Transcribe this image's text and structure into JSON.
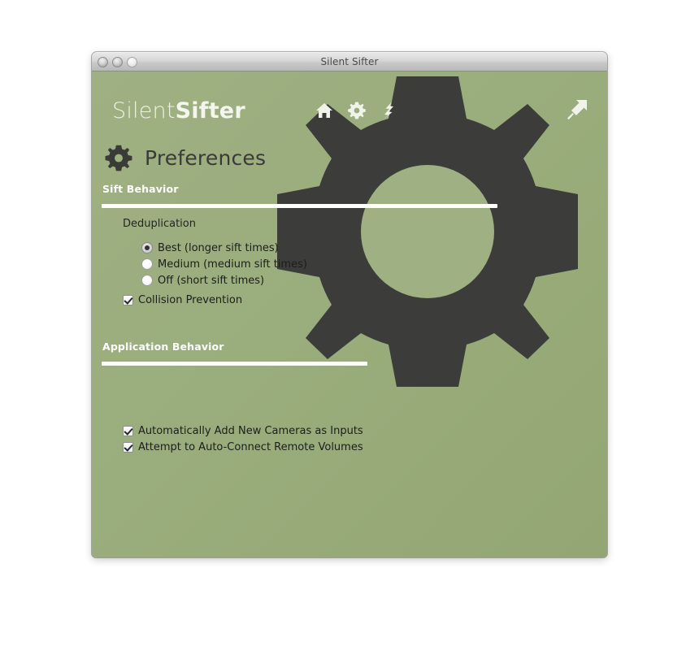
{
  "window": {
    "title": "Silent Sifter",
    "controls": [
      {
        "name": "close-button"
      },
      {
        "name": "minimize-button"
      },
      {
        "name": "zoom-button"
      }
    ]
  },
  "brand": {
    "prefix": "Silent",
    "suffix": "Sifter"
  },
  "toolbar": {
    "items": [
      {
        "name": "home-icon",
        "label": "Home"
      },
      {
        "name": "gear-icon",
        "label": "Preferences"
      },
      {
        "name": "sift-bolt-icon",
        "label": "Sift"
      }
    ],
    "share": {
      "name": "share-arrow-icon",
      "label": "Share"
    }
  },
  "page": {
    "title": "Preferences",
    "icon": "gear-icon"
  },
  "sections": [
    {
      "id": "sift-behavior",
      "title": "Sift Behavior",
      "group_label": "Deduplication",
      "radios": [
        {
          "label": "Best (longer sift times)",
          "checked": true
        },
        {
          "label": "Medium (medium sift times)",
          "checked": false
        },
        {
          "label": "Off (short sift times)",
          "checked": false
        }
      ],
      "checkbox": {
        "label": "Collision Prevention",
        "checked": true
      }
    },
    {
      "id": "application-behavior",
      "title": "Application Behavior",
      "checkboxes": [
        {
          "label": "Automatically Add New Cameras as Inputs",
          "checked": true
        },
        {
          "label": "Attempt to Auto-Connect Remote Volumes",
          "checked": true
        }
      ]
    }
  ],
  "colors": {
    "background_green_light": "#9fb082",
    "background_green_dark": "#93a673",
    "gear_dark": "#3c3c3b",
    "rule_white": "#ffffff",
    "title_text": "#4a4a4a",
    "heading_text": "#3a3a38"
  }
}
